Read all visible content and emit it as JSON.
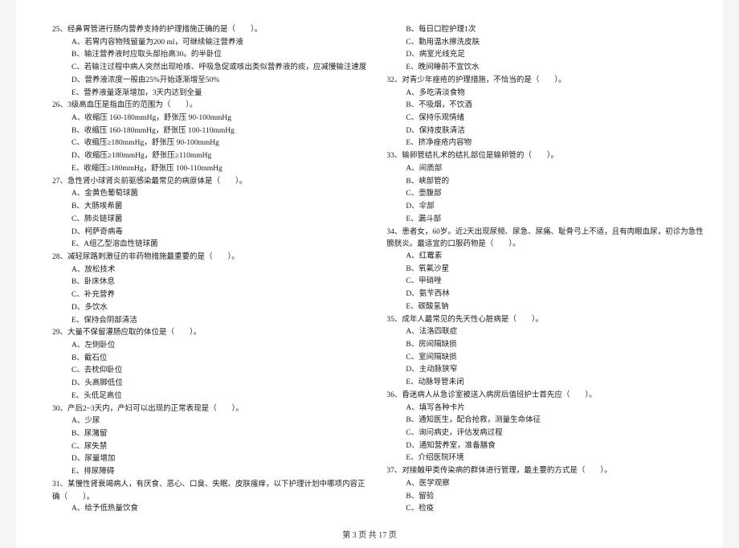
{
  "left": {
    "items": [
      {
        "type": "q",
        "t": "25、经鼻胃管进行肠内营养支持的护理措施正确的是（　　）。"
      },
      {
        "type": "opt",
        "t": "A、若胃内容物残留量为200 ml，可继续输注营养液"
      },
      {
        "type": "opt",
        "t": "B、输注营养液时应取头部抬高30。的半卧位"
      },
      {
        "type": "opt",
        "t": "C、若输注过程中病人突然出现呛咳、呼吸急促或咳出类似营养液的痰，应减慢输注速度"
      },
      {
        "type": "opt",
        "t": "D、营养液浓度一般由25%开始逐渐增至50%"
      },
      {
        "type": "opt",
        "t": "E、营养液量逐渐增加，3天内达到全量"
      },
      {
        "type": "q",
        "t": "26、3级高血压是指血压的范围为（　　）。"
      },
      {
        "type": "opt",
        "t": "A、收缩压 160-180mmHg，舒张压 90-100mmHg"
      },
      {
        "type": "opt",
        "t": "B、收缩压 160-180mmHg，舒张压 100-110mmHg"
      },
      {
        "type": "opt",
        "t": "C、收缩压≥180mmHg，舒张压 90-100mmHg"
      },
      {
        "type": "opt",
        "t": "D、收缩压≥180mmHg，舒张压≥110mmHg"
      },
      {
        "type": "opt",
        "t": "E、收缩压≥180mmHg，舒张压 100-110mmHg"
      },
      {
        "type": "q",
        "t": "27、急性肾小球肾炎前驱感染最常见的病原体是（　　）。"
      },
      {
        "type": "opt",
        "t": "A、金黄色葡萄球菌"
      },
      {
        "type": "opt",
        "t": "B、大肠埃希菌"
      },
      {
        "type": "opt",
        "t": "C、肺炎链球菌"
      },
      {
        "type": "opt",
        "t": "D、柯萨奇病毒"
      },
      {
        "type": "opt",
        "t": "E、A组乙型溶血性链球菌"
      },
      {
        "type": "q",
        "t": "28、减轻尿路刺激征的非药物措施最重要的是（　　）。"
      },
      {
        "type": "opt",
        "t": "A、放松技术"
      },
      {
        "type": "opt",
        "t": "B、卧床休息"
      },
      {
        "type": "opt",
        "t": "C、补充营养"
      },
      {
        "type": "opt",
        "t": "D、多饮水"
      },
      {
        "type": "opt",
        "t": "E、保持会阴部清洁"
      },
      {
        "type": "q",
        "t": "29、大量不保留灌肠应取的体位是（　　）。"
      },
      {
        "type": "opt",
        "t": "A、左侧卧位"
      },
      {
        "type": "opt",
        "t": "B、截石位"
      },
      {
        "type": "opt",
        "t": "C、去枕仰卧位"
      },
      {
        "type": "opt",
        "t": "D、头高脚低位"
      },
      {
        "type": "opt",
        "t": "E、头低足高位"
      },
      {
        "type": "q",
        "t": "30、产后2~3天内，产妇可以出现的正常表现是（　　）。"
      },
      {
        "type": "opt",
        "t": "A、少尿"
      },
      {
        "type": "opt",
        "t": "B、尿潴留"
      },
      {
        "type": "opt",
        "t": "C、尿失禁"
      },
      {
        "type": "opt",
        "t": "D、尿量增加"
      },
      {
        "type": "opt",
        "t": "E、排尿障碍"
      },
      {
        "type": "q",
        "t": "31、某慢性肾衰竭病人，有厌食、恶心、口臭、失眠、皮肤瘙痒，以下护理计划中哪项内容正"
      },
      {
        "type": "stem",
        "t": "确（　　）。"
      },
      {
        "type": "opt",
        "t": "A、给予低热量饮食"
      }
    ]
  },
  "right": {
    "items": [
      {
        "type": "opt",
        "t": "B、每日口腔护理1次"
      },
      {
        "type": "opt",
        "t": "C、勤用温水擦洗皮肤"
      },
      {
        "type": "opt",
        "t": "D、病室光线充足"
      },
      {
        "type": "opt",
        "t": "E、晚间睡前不宜饮水"
      },
      {
        "type": "q",
        "t": "32、对青少年痤疮的护理措施，不恰当的是（　　）。"
      },
      {
        "type": "opt",
        "t": "A、多吃清淡食物"
      },
      {
        "type": "opt",
        "t": "B、不吸烟，不饮酒"
      },
      {
        "type": "opt",
        "t": "C、保持乐观情绪"
      },
      {
        "type": "opt",
        "t": "D、保持皮肤清洁"
      },
      {
        "type": "opt",
        "t": "E、挤净痤疮内容物"
      },
      {
        "type": "q",
        "t": "33、输卵管结扎术的结扎部位是输卵管的（　　）。"
      },
      {
        "type": "opt",
        "t": "A、间质部"
      },
      {
        "type": "opt",
        "t": "B、峡部管的"
      },
      {
        "type": "opt",
        "t": "C、壶腹部"
      },
      {
        "type": "opt",
        "t": "D、伞部"
      },
      {
        "type": "opt",
        "t": "E、漏斗部"
      },
      {
        "type": "q",
        "t": "34、患者女，60岁。近2天出现尿频、尿急、尿痛、耻骨弓上不适，且有肉眼血尿，初诊为急性"
      },
      {
        "type": "stem",
        "t": "膀胱炎。最适宜的口服药物是（　　）。"
      },
      {
        "type": "opt",
        "t": "A、红霉素"
      },
      {
        "type": "opt",
        "t": "B、氧氟沙星"
      },
      {
        "type": "opt",
        "t": "C、甲硝唑"
      },
      {
        "type": "opt",
        "t": "D、氨苄西林"
      },
      {
        "type": "opt",
        "t": "E、碳酸氢钠"
      },
      {
        "type": "q",
        "t": "35、成年人最常见的先天性心脏病是（　　）。"
      },
      {
        "type": "opt",
        "t": "A、法洛四联症"
      },
      {
        "type": "opt",
        "t": "B、房间隔缺损"
      },
      {
        "type": "opt",
        "t": "C、室间隔缺损"
      },
      {
        "type": "opt",
        "t": "D、主动脉狭窄"
      },
      {
        "type": "opt",
        "t": "E、动脉导管未闭"
      },
      {
        "type": "q",
        "t": "36、昏迷病人从急诊室被送入病房后值班护士首先应（　　）。"
      },
      {
        "type": "opt",
        "t": "A、填写各种卡片"
      },
      {
        "type": "opt",
        "t": "B、通知医生，配合抢救，测量生命体征"
      },
      {
        "type": "opt",
        "t": "C、询问病史，评估发病过程"
      },
      {
        "type": "opt",
        "t": "D、通知营养室，准备膳食"
      },
      {
        "type": "opt",
        "t": "E、介绍医院环境"
      },
      {
        "type": "q",
        "t": "37、对接触甲类传染病的群体进行管理，最主要的方式是（　　）。"
      },
      {
        "type": "opt",
        "t": "A、医学观察"
      },
      {
        "type": "opt",
        "t": "B、留验"
      },
      {
        "type": "opt",
        "t": "C、检疫"
      }
    ]
  },
  "footer": "第 3 页 共 17 页"
}
